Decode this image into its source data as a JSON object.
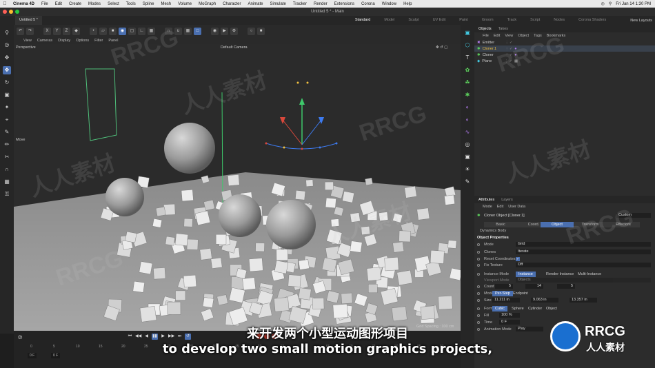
{
  "menubar": {
    "app": "Cinema 4D",
    "items": [
      "File",
      "Edit",
      "Create",
      "Modes",
      "Select",
      "Tools",
      "Spline",
      "Mesh",
      "Volume",
      "MoGraph",
      "Character",
      "Animate",
      "Simulate",
      "Tracker",
      "Render",
      "Extensions",
      "Corona",
      "Window",
      "Help"
    ],
    "clock": "Fri Jan 14  1:30 PM"
  },
  "window": {
    "title": "Untitled 5 * - Main"
  },
  "tabs": {
    "document": "Untitled 5 *",
    "layouts": [
      "Standard",
      "Model",
      "Sculpt",
      "UV Edit",
      "Paint",
      "Groom",
      "Track",
      "Script",
      "Nodes",
      "Corona Shaders"
    ],
    "active_layout": "Standard",
    "new_layouts": "New Layouts"
  },
  "viewport": {
    "menu": [
      "View",
      "Cameras",
      "Display",
      "Options",
      "Filter",
      "Panel"
    ],
    "name": "Perspective",
    "camera": "Default Camera",
    "tool_label": "Move",
    "grid_spacing": "Grid Spacing : 100 cm"
  },
  "timeline": {
    "ticks": [
      "0",
      "5",
      "10",
      "15",
      "20",
      "25",
      "30",
      "35",
      "40",
      "45",
      "50",
      "55",
      "60",
      "65",
      "70",
      "75",
      "80",
      "85",
      "90"
    ],
    "start_frame": "0 F",
    "current_frame": "0 F"
  },
  "objects_panel": {
    "tabs": [
      "Objects",
      "Takes"
    ],
    "menu": [
      "File",
      "Edit",
      "View",
      "Object",
      "Tags",
      "Bookmarks"
    ],
    "items": [
      {
        "name": "Emitter"
      },
      {
        "name": "Cloner.1"
      },
      {
        "name": "Cloner"
      },
      {
        "name": "Plane"
      }
    ]
  },
  "attributes": {
    "tabs": [
      "Attributes",
      "Layers"
    ],
    "menu": [
      "Mode",
      "Edit",
      "User Data"
    ],
    "object_title": "Cloner Object [Cloner.1]",
    "preset": "Custom",
    "section_tabs": [
      "Basic",
      "Coord.",
      "Object",
      "Transform",
      "Effectors"
    ],
    "active_section": "Object",
    "dynamics_body": "Dynamics Body",
    "heading": "Object Properties",
    "mode_label": "Mode",
    "mode_value": "Grid",
    "clones_label": "Clones",
    "clones_value": "Iterate",
    "reset_label": "Reset Coordinates",
    "fix_label": "Fix Texture",
    "fix_value": "Off",
    "instance_label": "Instance Mode",
    "instance_options": [
      "Instance",
      "Render Instance",
      "Multi-Instance"
    ],
    "viewport_mode_label": "Viewport Mode",
    "viewport_mode_value": "Objects",
    "count_label": "Count",
    "count_values": [
      "5",
      "14",
      "5"
    ],
    "mode2_label": "Mode",
    "mode2_options": [
      "Per-Step",
      "Endpoint"
    ],
    "size_label": "Size",
    "size_values": [
      "11.211 in",
      "9.063 in",
      "13.357 in"
    ],
    "form_label": "Form",
    "form_options": [
      "Cubic",
      "Sphere",
      "Cylinder",
      "Object"
    ],
    "fill_label": "Fill",
    "fill_value": "100 %",
    "time_label": "Time",
    "time_value": "0 F",
    "anim_label": "Animation Mode",
    "anim_value": "Play"
  },
  "subtitles": {
    "cn": "来开发两个小型运动图形项目",
    "en": "to develop two small motion graphics projects,"
  },
  "watermark": {
    "text": "RRCG",
    "cn": "人人素材"
  },
  "logo": {
    "main": "RRCG",
    "sub": "人人素材"
  },
  "colors": {
    "accent": "#4a6fb0",
    "axis_red": "#d9483b",
    "axis_green": "#3ec96b",
    "axis_blue": "#3d7bf0"
  }
}
